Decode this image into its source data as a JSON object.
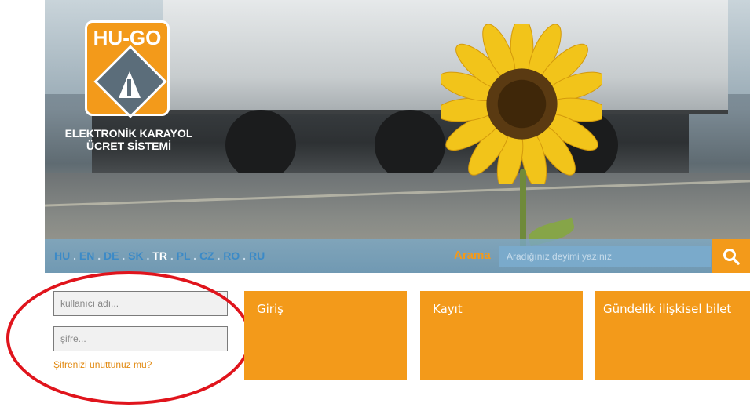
{
  "logo": {
    "text": "HU-GO",
    "caption_line1": "ELEKTRONİK KARAYOL",
    "caption_line2": "ÜCRET SİSTEMİ",
    "icon": "road-sign-icon"
  },
  "nav": {
    "languages": [
      "HU",
      "EN",
      "DE",
      "SK",
      "TR",
      "PL",
      "CZ",
      "RO",
      "RU"
    ],
    "active_language": "TR",
    "separator": " . "
  },
  "search": {
    "label": "Arama",
    "placeholder": "Aradığınız deyimi yazınız",
    "button_icon": "search-icon"
  },
  "login": {
    "username_placeholder": "kullanıcı adı...",
    "password_placeholder": "şifre...",
    "forgot_link": "Şifrenizi unuttunuz mu?"
  },
  "tiles": [
    {
      "label": "Giriş"
    },
    {
      "label": "Kayıt"
    },
    {
      "label": "Gündelik ilişkisel bilet"
    }
  ],
  "colors": {
    "accent": "#f39a1a",
    "nav_bar": "#7aa8c4",
    "language_link": "#3b8ac7",
    "highlight_circle": "#e0141c"
  }
}
